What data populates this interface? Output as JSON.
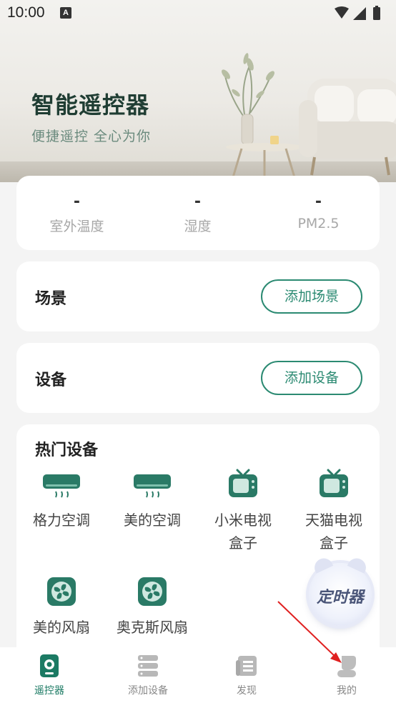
{
  "status_bar": {
    "time": "10:00",
    "notif_letter": "A"
  },
  "hero": {
    "title": "智能遥控器",
    "subtitle": "便捷遥控  全心为你"
  },
  "environment": [
    {
      "value": "-",
      "label": "室外温度"
    },
    {
      "value": "-",
      "label": "湿度"
    },
    {
      "value": "-",
      "label": "PM2.5"
    }
  ],
  "scene": {
    "title": "场景",
    "button": "添加场景"
  },
  "device": {
    "title": "设备",
    "button": "添加设备"
  },
  "hot_devices": {
    "title": "热门设备",
    "items": [
      {
        "label": "格力空调",
        "icon": "air-conditioner-icon"
      },
      {
        "label": "美的空调",
        "icon": "air-conditioner-icon"
      },
      {
        "label": "小米电视盒子",
        "icon": "tv-icon"
      },
      {
        "label": "天猫电视盒子",
        "icon": "tv-icon"
      },
      {
        "label": "美的风扇",
        "icon": "fan-icon"
      },
      {
        "label": "奥克斯风扇",
        "icon": "fan-icon"
      }
    ]
  },
  "timer": {
    "label": "定时器"
  },
  "nav": [
    {
      "label": "遥控器",
      "icon": "remote-icon",
      "active": true
    },
    {
      "label": "添加设备",
      "icon": "server-stack-icon",
      "active": false
    },
    {
      "label": "发现",
      "icon": "article-icon",
      "active": false
    },
    {
      "label": "我的",
      "icon": "user-icon",
      "active": false
    }
  ],
  "colors": {
    "accent": "#2b8a72",
    "icon_green": "#2a7a66",
    "title_dark": "#1f3d33",
    "annotation_arrow": "#e02020"
  }
}
